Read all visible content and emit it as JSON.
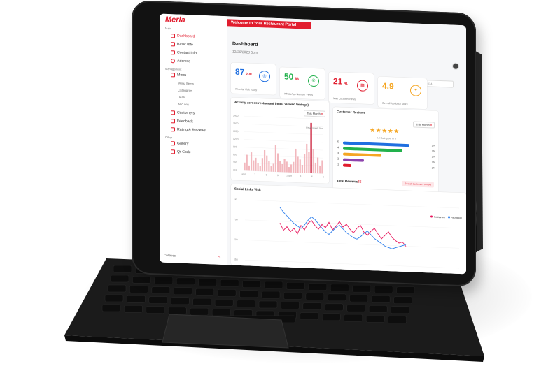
{
  "brand": {
    "logo_text": "Merla",
    "accent": "#e11d2e"
  },
  "sidebar": {
    "group_main": "Main",
    "group_management": "Management",
    "group_other": "Other",
    "items": [
      {
        "label": "Dashboard",
        "icon": "chart-icon"
      },
      {
        "label": "Basic Info",
        "icon": "info-icon"
      },
      {
        "label": "Contact Info",
        "icon": "phone-icon"
      },
      {
        "label": "Address",
        "icon": "pin-icon"
      },
      {
        "label": "Menu",
        "icon": "menu-icon"
      },
      {
        "label": "Customers",
        "icon": "users-icon"
      },
      {
        "label": "Feedback",
        "icon": "feedback-icon"
      },
      {
        "label": "Rating & Reviews",
        "icon": "star-icon"
      },
      {
        "label": "Gallery",
        "icon": "gallery-icon"
      },
      {
        "label": "Qr Code",
        "icon": "qr-icon"
      }
    ],
    "menu_sub": [
      "Menu Items",
      "Categories",
      "Deals",
      "Add ons"
    ],
    "collapse_label": "Collapse"
  },
  "header": {
    "banner": "Welcome to Your Restaurant Portal",
    "title": "Dashboard",
    "date": "12/30/2023 5pm",
    "date_picker": "02-16-2024"
  },
  "stats": [
    {
      "value": "87",
      "secondary": "200",
      "label": "Website Visit Today",
      "color": "#1f6fe0",
      "icon": "globe-icon"
    },
    {
      "value": "50",
      "secondary": "83",
      "label": "WhatsApp Number Views",
      "color": "#22b14c",
      "icon": "whatsapp-icon"
    },
    {
      "value": "21",
      "secondary": "41",
      "label": "Map Location Views",
      "color": "#e11d2e",
      "icon": "map-icon"
    },
    {
      "value": "4.9",
      "secondary": "",
      "label": "Overall feedback score",
      "color": "#f5a623",
      "icon": "star-icon"
    }
  ],
  "activity": {
    "title": "Activity across restaurant (most viewed timings)",
    "filter": "This Month",
    "highlight_label": "8:00am Crowdy Days"
  },
  "reviews": {
    "title": "Customer Reviews",
    "filter": "This Month",
    "stars": "★★★★★",
    "rating_text": "4.9 Rating out of 5",
    "rows": [
      {
        "label": "5",
        "fraction": 0.95,
        "color": "#1f6fe0",
        "pct": "2%"
      },
      {
        "label": "4",
        "fraction": 0.85,
        "color": "#22b14c",
        "pct": "2%"
      },
      {
        "label": "3",
        "fraction": 0.55,
        "color": "#f5a623",
        "pct": "2%"
      },
      {
        "label": "2",
        "fraction": 0.3,
        "color": "#8e44ad",
        "pct": "2%"
      },
      {
        "label": "1",
        "fraction": 0.12,
        "color": "#e11d2e",
        "pct": "2%"
      }
    ],
    "total_label": "Total Reviews",
    "total_value": "65",
    "see_all": "See all customers review"
  },
  "social": {
    "title": "Social Links Visit",
    "legend": [
      {
        "name": "Instagram",
        "color": "#e8175d"
      },
      {
        "name": "Facebook",
        "color": "#2f80ed"
      }
    ]
  },
  "chart_data": [
    {
      "type": "bar",
      "title": "Activity across restaurant (most viewed timings)",
      "y_ticks": [
        "2400",
        "1800",
        "1600",
        "1200",
        "900",
        "600",
        "300",
        "100"
      ],
      "x_ticks": [
        "12am",
        "3",
        "6",
        "9",
        "12pm",
        "3",
        "6",
        "9"
      ],
      "values": [
        3,
        6,
        2,
        7,
        4,
        5,
        3,
        2,
        5,
        8,
        6,
        4,
        2,
        3,
        10,
        7,
        4,
        3,
        5,
        4,
        2,
        3,
        4,
        9,
        6,
        5,
        3,
        7,
        11,
        8,
        19,
        9,
        4,
        6,
        3,
        5
      ],
      "highlight_index": 30
    },
    {
      "type": "line",
      "title": "Social Links Visit",
      "y_ticks": [
        "1K",
        "750",
        "500",
        "250"
      ],
      "series": [
        {
          "name": "Instagram",
          "values": [
            640,
            520,
            580,
            500,
            560,
            470,
            610,
            540,
            650,
            700,
            620,
            560,
            640,
            590,
            680,
            560,
            620,
            700,
            610,
            660,
            580,
            520,
            600,
            650,
            540,
            490,
            560,
            610,
            520,
            440,
            500,
            560,
            470,
            420,
            380,
            400,
            330
          ]
        },
        {
          "name": "Facebook",
          "values": [
            900,
            820,
            760,
            700,
            640,
            600,
            560,
            620,
            700,
            760,
            720,
            650,
            580,
            520,
            480,
            540,
            600,
            640,
            580,
            520,
            480,
            440,
            420,
            460,
            520,
            560,
            500,
            440,
            400,
            360,
            320,
            300,
            280,
            300,
            320,
            340,
            360
          ]
        }
      ]
    }
  ]
}
